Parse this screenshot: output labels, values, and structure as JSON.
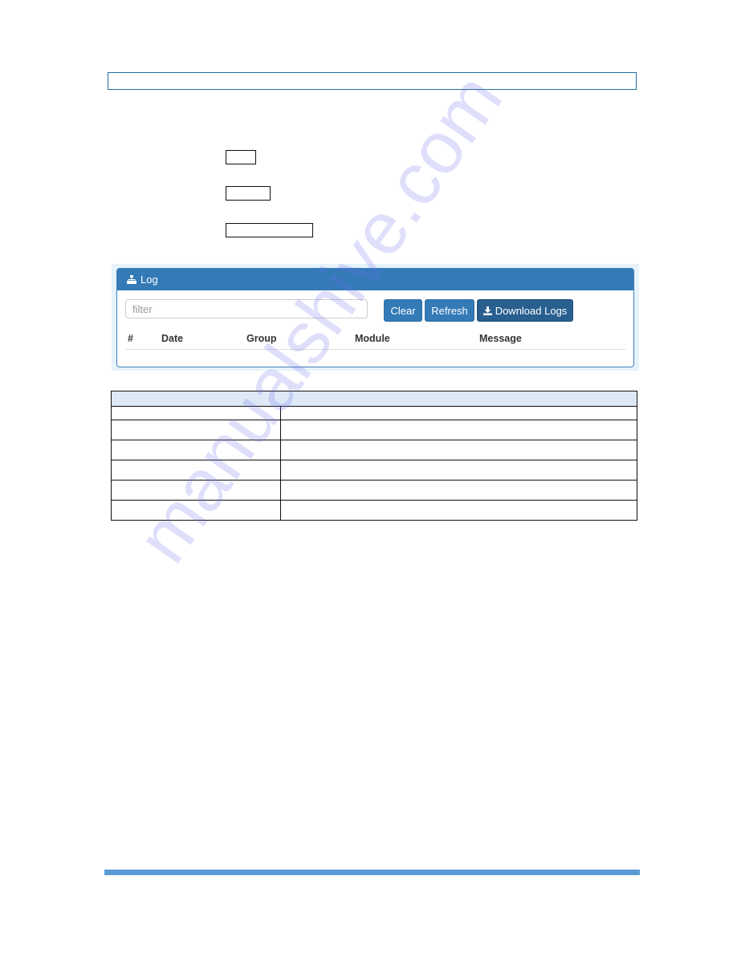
{
  "page": {
    "title_box_text": "",
    "key_boxes": [
      "",
      "",
      ""
    ]
  },
  "log_panel": {
    "title": "Log",
    "title_icon": "sitemap-icon",
    "filter_placeholder": "filter",
    "filter_value": "",
    "buttons": {
      "clear": "Clear",
      "refresh": "Refresh",
      "download": "Download Logs",
      "download_icon": "download-icon"
    },
    "columns": [
      "#",
      "Date",
      "Group",
      "Module",
      "Message"
    ],
    "rows": []
  },
  "param_table": {
    "header": "",
    "rows": [
      [
        "",
        ""
      ],
      [
        "",
        ""
      ],
      [
        "",
        ""
      ],
      [
        "",
        ""
      ],
      [
        "",
        ""
      ],
      [
        "",
        ""
      ]
    ]
  },
  "watermark": "manualshive.com",
  "colors": {
    "panel_header": "#337ab7",
    "button_primary": "#337ab7",
    "button_download": "#285f8f",
    "table_header_bg": "#dde9f5",
    "footer_bar": "#5b9bd5",
    "title_box_border": "#1f6f9a"
  }
}
